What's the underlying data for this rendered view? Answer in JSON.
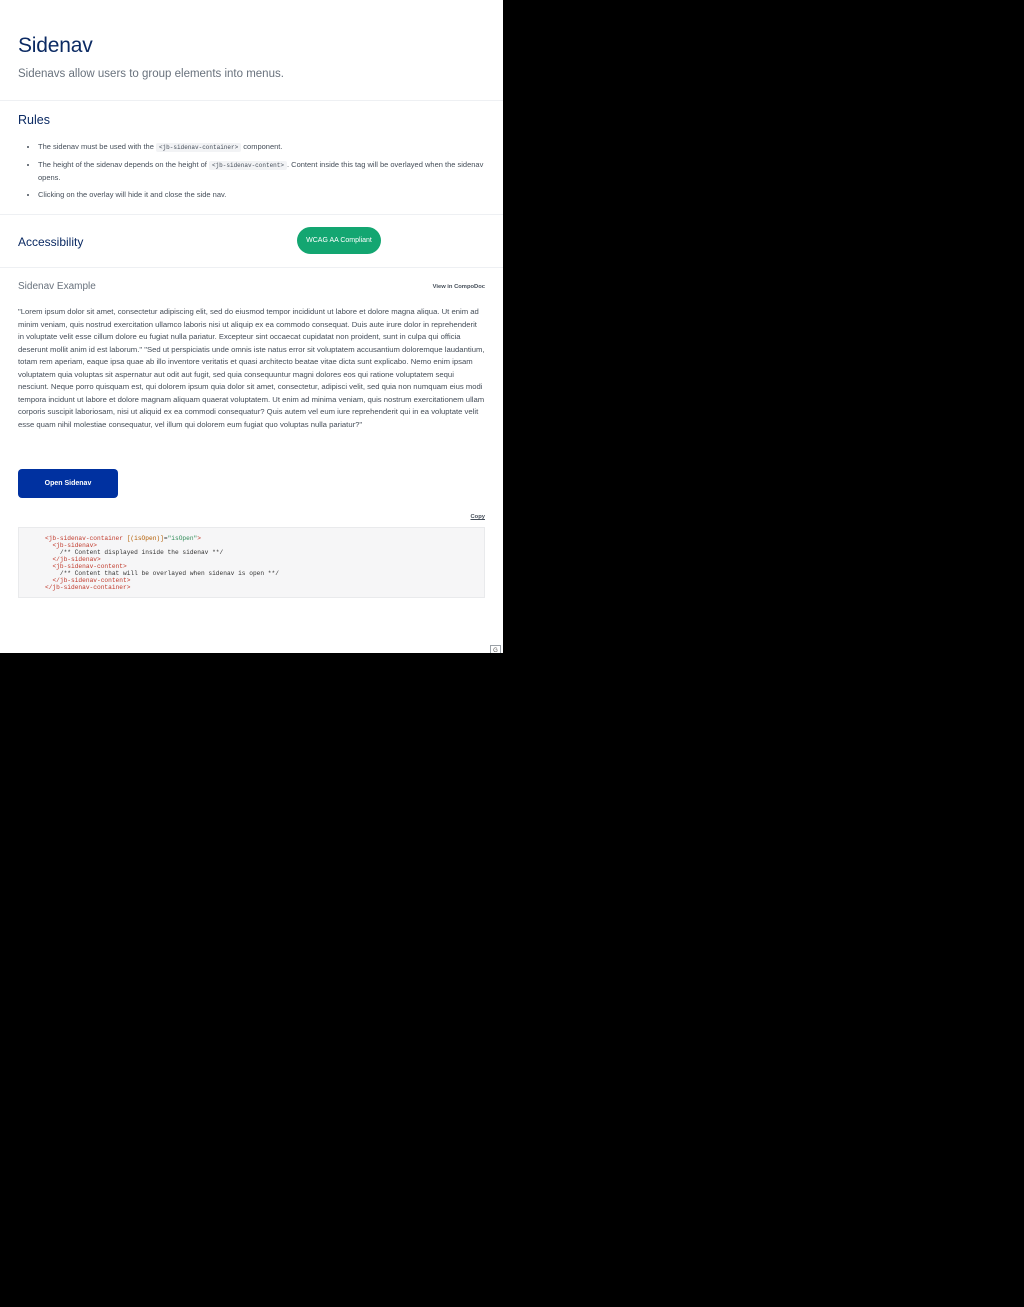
{
  "header": {
    "title": "Sidenav",
    "subtitle": "Sidenavs allow users to group elements into menus."
  },
  "rules": {
    "title": "Rules",
    "items": [
      {
        "pre": "The sidenav must be used with the ",
        "code": "<jb-sidenav-container>",
        "post": " component."
      },
      {
        "pre": "The height of the sidenav depends on the height of ",
        "code": "<jb-sidenav-content>",
        "post": ". Content inside this tag will be overlayed when the sidenav opens."
      },
      {
        "pre": "Clicking on the overlay will hide it and close the side nav.",
        "code": "",
        "post": ""
      }
    ]
  },
  "accessibility": {
    "title": "Accessibility",
    "badge": "WCAG AA Compliant"
  },
  "example": {
    "title": "Sidenav Example",
    "compodoc_link": "View in CompoDoc",
    "lorem": "\"Lorem ipsum dolor sit amet, consectetur adipiscing elit, sed do eiusmod tempor incididunt ut labore et dolore magna aliqua. Ut enim ad minim veniam, quis nostrud exercitation ullamco laboris nisi ut aliquip ex ea commodo consequat. Duis aute irure dolor in reprehenderit in voluptate velit esse cillum dolore eu fugiat nulla pariatur. Excepteur sint occaecat cupidatat non proident, sunt in culpa qui officia deserunt mollit anim id est laborum.\" \"Sed ut perspiciatis unde omnis iste natus error sit voluptatem accusantium doloremque laudantium, totam rem aperiam, eaque ipsa quae ab illo inventore veritatis et quasi architecto beatae vitae dicta sunt explicabo. Nemo enim ipsam voluptatem quia voluptas sit aspernatur aut odit aut fugit, sed quia consequuntur magni dolores eos qui ratione voluptatem sequi nesciunt. Neque porro quisquam est, qui dolorem ipsum quia dolor sit amet, consectetur, adipisci velit, sed quia non numquam eius modi tempora incidunt ut labore et dolore magnam aliquam quaerat voluptatem. Ut enim ad minima veniam, quis nostrum exercitationem ullam corporis suscipit laboriosam, nisi ut aliquid ex ea commodi consequatur? Quis autem vel eum iure reprehenderit qui in ea voluptate velit esse quam nihil molestiae consequatur, vel illum qui dolorem eum fugiat quo voluptas nulla pariatur?\"",
    "button_label": "Open Sidenav",
    "copy_label": "Copy",
    "code_lines": [
      {
        "indent": 0,
        "parts": [
          {
            "t": "tag",
            "v": "<jb-sidenav-container"
          },
          {
            "t": "plain",
            "v": " "
          },
          {
            "t": "attr",
            "v": "[(isOpen)]"
          },
          {
            "t": "plain",
            "v": "="
          },
          {
            "t": "str",
            "v": "\"isOpen\""
          },
          {
            "t": "tag",
            "v": ">"
          }
        ]
      },
      {
        "indent": 2,
        "parts": [
          {
            "t": "tag",
            "v": "<jb-sidenav>"
          }
        ]
      },
      {
        "indent": 4,
        "parts": [
          {
            "t": "cmt",
            "v": "/** Content displayed inside the sidenav **/"
          }
        ]
      },
      {
        "indent": 2,
        "parts": [
          {
            "t": "tag",
            "v": "</jb-sidenav>"
          }
        ]
      },
      {
        "indent": 2,
        "parts": [
          {
            "t": "tag",
            "v": "<jb-sidenav-content>"
          }
        ]
      },
      {
        "indent": 4,
        "parts": [
          {
            "t": "cmt",
            "v": "/** Content that will be overlayed when sidenav is open **/"
          }
        ]
      },
      {
        "indent": 2,
        "parts": [
          {
            "t": "tag",
            "v": "</jb-sidenav-content>"
          }
        ]
      },
      {
        "indent": 0,
        "parts": [
          {
            "t": "tag",
            "v": "</jb-sidenav-container>"
          }
        ]
      }
    ]
  },
  "corner_widget": "G",
  "colors": {
    "title": "#0b2a63",
    "button": "#0031a0",
    "badge": "#13a671"
  }
}
